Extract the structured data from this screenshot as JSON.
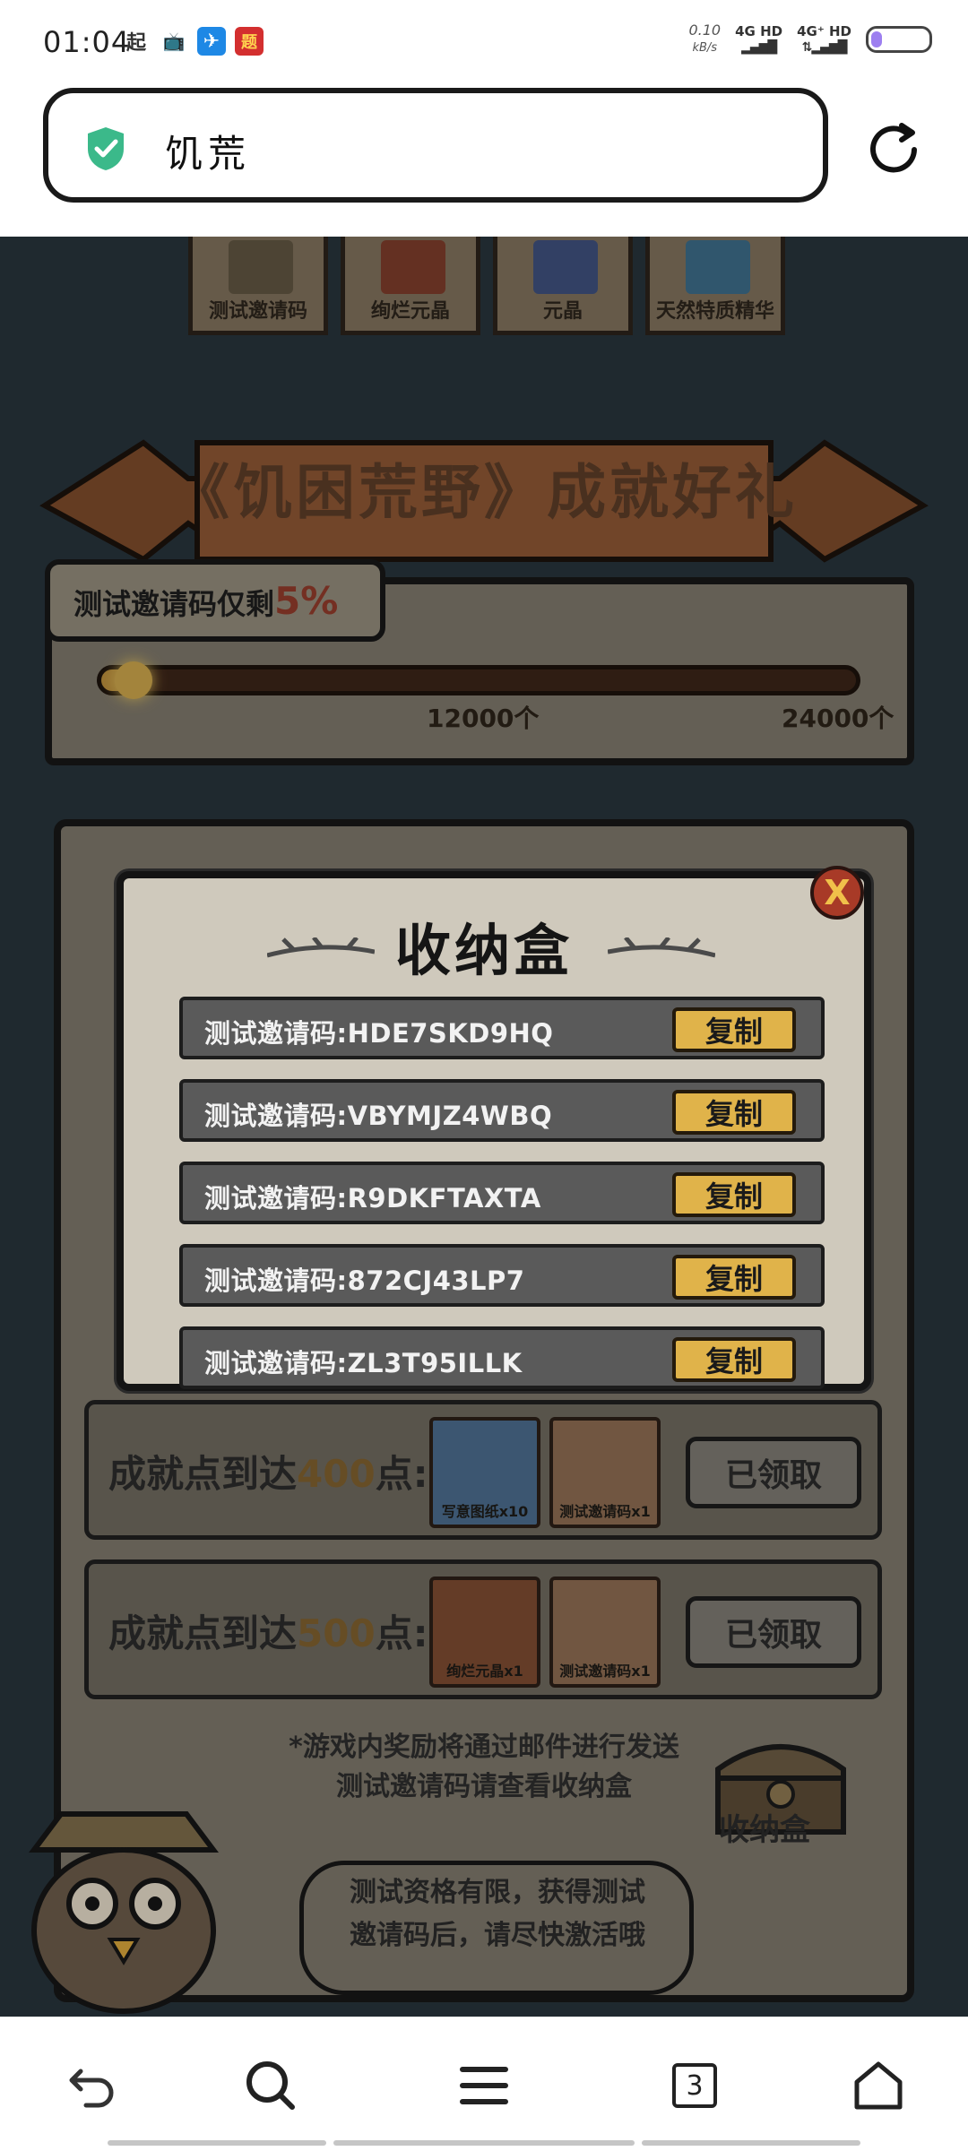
{
  "status_bar": {
    "time": "01:04",
    "app_icons": [
      "起",
      "▶",
      "✈",
      "题"
    ],
    "speed_value": "0.10",
    "speed_unit": "kB/s",
    "network1": "4G HD",
    "network2": "4G⁺ HD",
    "battery_level": 0.2,
    "battery_color": "#9d7ff0"
  },
  "browser": {
    "url_text": "饥荒"
  },
  "game": {
    "reward_tiles": [
      "测试邀请码",
      "绚烂元晶",
      "元晶",
      "天然特质精华"
    ],
    "banner_title": "《饥困荒野》成就好礼",
    "progress": {
      "label": "测试邀请码仅剩",
      "percent": "5%",
      "fraction": 0.05,
      "milestones": [
        "12000个",
        "24000个"
      ]
    },
    "achievements": [
      {
        "label_prefix": "成就点到达",
        "points": "400",
        "label_suffix": "点:",
        "items": [
          "写意图纸x10",
          "测试邀请码x1"
        ],
        "button": "已领取"
      },
      {
        "label_prefix": "成就点到达",
        "points": "500",
        "label_suffix": "点:",
        "items": [
          "绚烂元晶x1",
          "测试邀请码x1"
        ],
        "button": "已领取"
      }
    ],
    "notice_line1": "*游戏内奖励将通过邮件进行发送",
    "notice_line2": "测试邀请码请查看收纳盒",
    "chest_label": "收纳盒",
    "tip_line1": "测试资格有限，获得测试",
    "tip_line2": "邀请码后，请尽快激活哦"
  },
  "modal": {
    "title": "收纳盒",
    "close_label": "X",
    "codes": [
      {
        "text": "测试邀请码:HDE7SKD9HQ",
        "copy": "复制"
      },
      {
        "text": "测试邀请码:VBYMJZ4WBQ",
        "copy": "复制"
      },
      {
        "text": "测试邀请码:R9DKFTAXTA",
        "copy": "复制"
      },
      {
        "text": "测试邀请码:872CJ43LP7",
        "copy": "复制"
      },
      {
        "text": "测试邀请码:ZL3T95ILLK",
        "copy": "复制"
      }
    ]
  },
  "bottom_nav": {
    "tab_count": "3"
  }
}
